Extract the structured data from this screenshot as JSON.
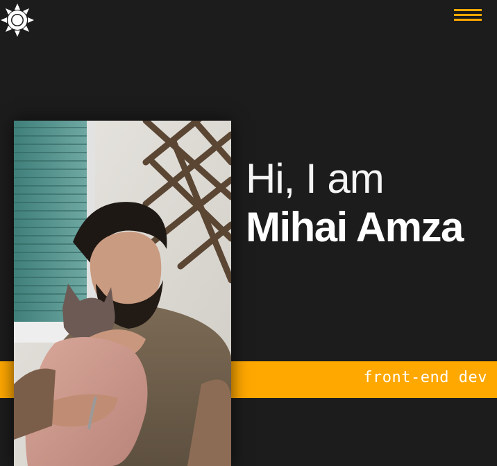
{
  "header": {
    "theme_toggle_icon": "sun-icon",
    "menu_icon": "hamburger-menu-icon",
    "accent_color": "#ffa800"
  },
  "hero": {
    "greeting": "Hi, I am",
    "name": "Mihai Amza",
    "role": "front-end dev",
    "photo_icon": "profile-photo"
  },
  "colors": {
    "background": "#1c1c1c",
    "accent": "#ffa800",
    "text": "#ffffff"
  }
}
